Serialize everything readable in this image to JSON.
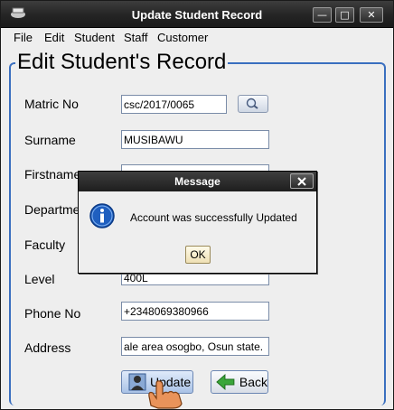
{
  "window": {
    "title": "Update Student Record"
  },
  "menubar": {
    "items": [
      "File",
      "Edit",
      "Student",
      "Staff",
      "Customer"
    ]
  },
  "form": {
    "group_title": "Edit Student's Record",
    "fields": [
      {
        "label": "Matric No",
        "value": "csc/2017/0065"
      },
      {
        "label": "Surname",
        "value": "MUSIBAWU"
      },
      {
        "label": "Firstname",
        "value": ""
      },
      {
        "label": "Departme",
        "value": ""
      },
      {
        "label": "Faculty",
        "value": ""
      },
      {
        "label": "Level",
        "value": "400L"
      },
      {
        "label": "Phone No",
        "value": "+2348069380966"
      },
      {
        "label": "Address",
        "value": "ale area osogbo, Osun state."
      }
    ],
    "search_icon": "search-magnifier-icon",
    "update_label": "Update",
    "back_label": "Back"
  },
  "dialog": {
    "title": "Message",
    "message": "Account was successfully Updated",
    "ok_label": "OK",
    "icon": "info-icon"
  },
  "colors": {
    "titlebar": "#242424",
    "group_border": "#3a6fbf",
    "info_icon": "#1f5fbf"
  }
}
